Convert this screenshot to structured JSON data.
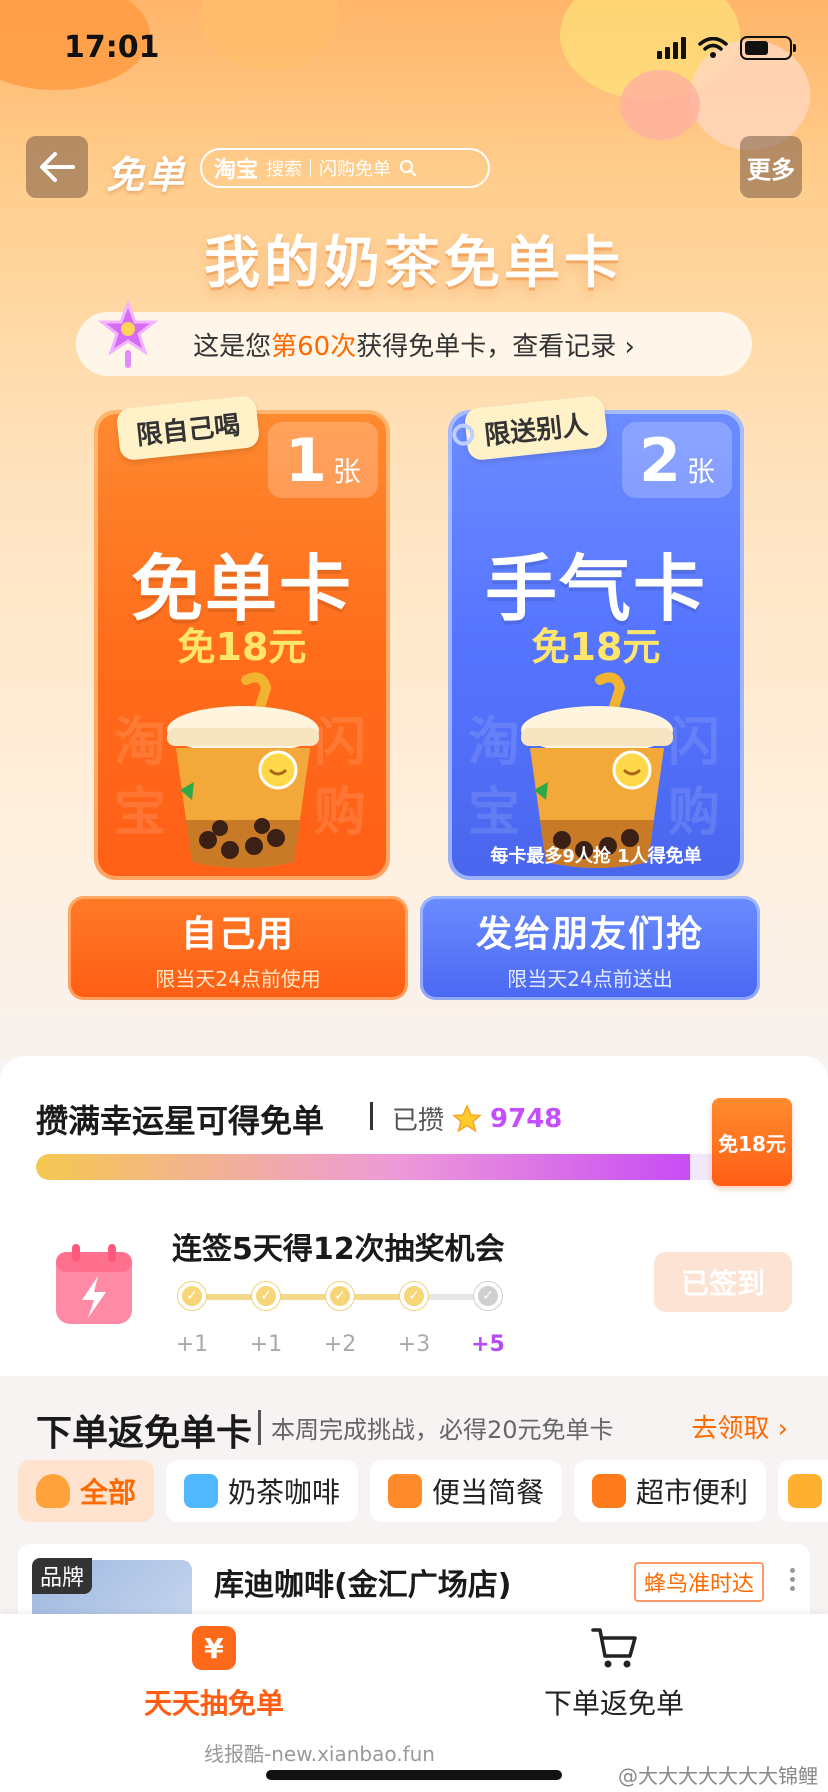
{
  "status_bar": {
    "time": "17:01"
  },
  "nav": {
    "title": "免单",
    "search_brand": "淘宝",
    "search_label": "搜索",
    "search_scope": "闪购免单",
    "more": "更多"
  },
  "hero": {
    "title": "我的奶茶免单卡",
    "record_prefix": "这是您",
    "record_highlight": "第60次",
    "record_suffix": "获得免单卡，查看记录 ›"
  },
  "cards": {
    "self": {
      "tag": "限自己喝",
      "count": "1",
      "unit": "张",
      "name": "免单卡",
      "value": "免18元",
      "wm1": "淘",
      "wm2": "闪",
      "wm3": "宝",
      "wm4": "购"
    },
    "give": {
      "tag": "限送别人",
      "count": "2",
      "unit": "张",
      "name": "手气卡",
      "value": "免18元",
      "wm1": "淘",
      "wm2": "闪",
      "wm3": "宝",
      "wm4": "购",
      "note": "每卡最多9人抢 1人得免单"
    }
  },
  "buttons": {
    "self": {
      "label": "自己用",
      "sub": "限当天24点前使用"
    },
    "give": {
      "label": "发给朋友们抢",
      "sub": "限当天24点前送出"
    }
  },
  "lucky": {
    "title": "攒满幸运星可得免单",
    "collected_label": "已攒",
    "collected_count": "9748",
    "progress": 0.87,
    "reward": "免18元"
  },
  "signin": {
    "title": "连签5天得12次抽奖机会",
    "rewards": [
      "+1",
      "+1",
      "+2",
      "+3",
      "+5"
    ],
    "button": "已签到"
  },
  "order": {
    "title": "下单返免单卡",
    "subtitle": "本周完成挑战，必得20元免单卡",
    "claim": "去领取 ›",
    "categories": [
      {
        "label": "全部",
        "color": "#ffa23a"
      },
      {
        "label": "奶茶咖啡",
        "color": "#4fb8ff"
      },
      {
        "label": "便当简餐",
        "color": "#ff8a2a"
      },
      {
        "label": "超市便利",
        "color": "#ff7a1a"
      }
    ]
  },
  "shop": {
    "brand_tag": "品牌",
    "name": "库迪咖啡(金汇广场店)",
    "delivery": "蜂鸟准时达"
  },
  "tabbar": {
    "lottery": "天天抽免单",
    "order": "下单返免单",
    "footer_watermark": "线报酷-new.xianbao.fun",
    "weibo_watermark": "@大大大大大大大锦鲤"
  },
  "colors": {
    "accent": "#ff6a00",
    "blue": "#5574ff",
    "purple": "#c84cf5"
  }
}
